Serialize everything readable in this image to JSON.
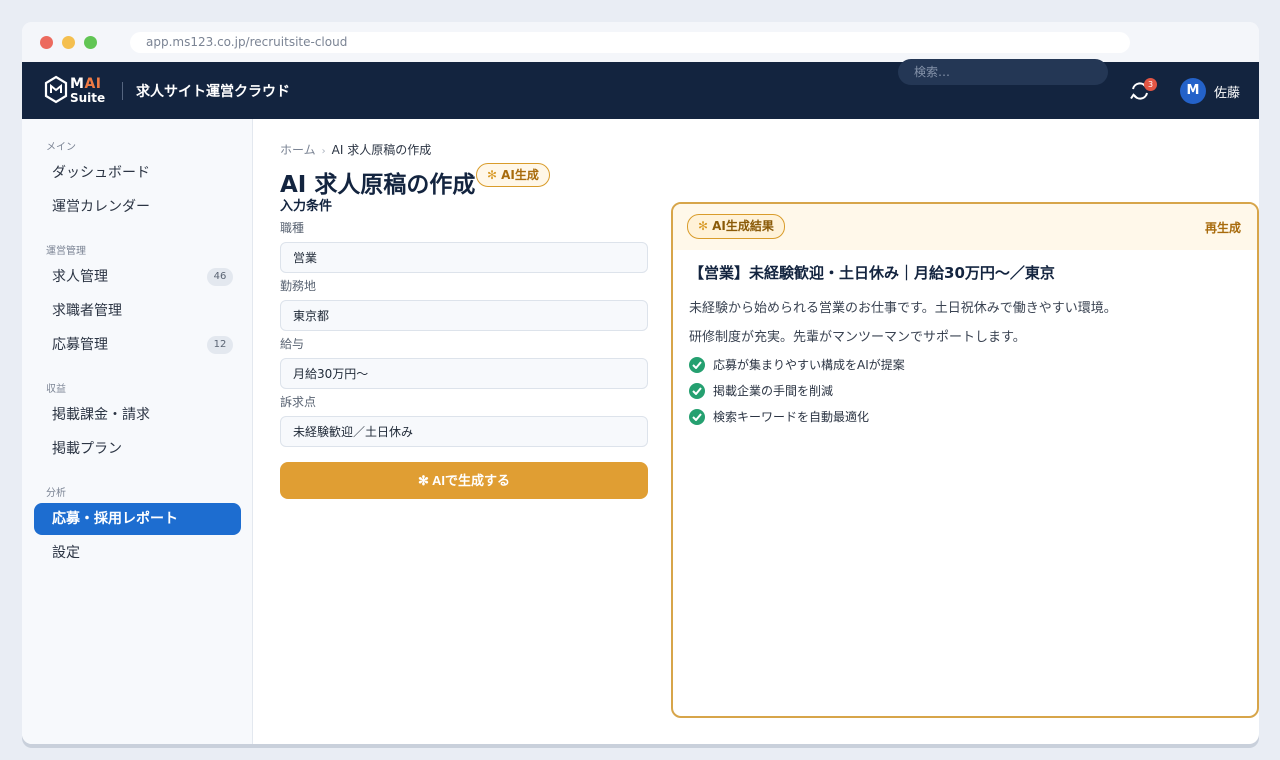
{
  "browser": {
    "url": "app.ms123.co.jp/recruitsite-cloud"
  },
  "topbar": {
    "logo_mai_m": "M",
    "logo_mai_ai": "AI",
    "logo_suite": "Suite",
    "app_title": "求人サイト運営クラウド",
    "search_placeholder": "検索…",
    "notification_count": "3",
    "avatar_initial": "M",
    "user_name": "佐藤"
  },
  "sidebar": {
    "sections": [
      {
        "label": "メイン"
      },
      {
        "label": "運営管理"
      },
      {
        "label": "収益"
      },
      {
        "label": "分析"
      }
    ],
    "items": [
      {
        "label": "ダッシュボード"
      },
      {
        "label": "運営カレンダー"
      },
      {
        "label": "求人管理",
        "count": "46"
      },
      {
        "label": "求職者管理"
      },
      {
        "label": "応募管理",
        "count": "12"
      },
      {
        "label": "掲載課金・請求"
      },
      {
        "label": "掲載プラン"
      },
      {
        "label": "応募・採用レポート",
        "active": true
      },
      {
        "label": "設定"
      }
    ]
  },
  "breadcrumb": {
    "home": "ホーム",
    "separator": "›",
    "current": "AI 求人原稿の作成"
  },
  "page": {
    "title": "AI 求人原稿の作成",
    "ai_badge": "AI生成",
    "section_label": "入力条件"
  },
  "form": {
    "fields": [
      {
        "label": "職種",
        "value": "営業"
      },
      {
        "label": "勤務地",
        "value": "東京都"
      },
      {
        "label": "給与",
        "value": "月給30万円〜"
      },
      {
        "label": "訴求点",
        "value": "未経験歓迎／土日休み"
      }
    ],
    "generate_button": "AIで生成する"
  },
  "result": {
    "badge": "AI生成結果",
    "regenerate": "再生成",
    "title": "【営業】未経験歓迎・土日休み｜月給30万円〜／東京",
    "paragraphs": [
      "未経験から始められる営業のお仕事です。土日祝休みで働きやすい環境。",
      "研修制度が充実。先輩がマンツーマンでサポートします。"
    ],
    "bullets": [
      "応募が集まりやすい構成をAIが提案",
      "掲載企業の手間を削減",
      "検索キーワードを自動最適化"
    ]
  },
  "colors": {
    "topbar": "#13243f",
    "active_nav": "#1d6dd0",
    "accent": "#e09e33",
    "check": "#25a070"
  }
}
